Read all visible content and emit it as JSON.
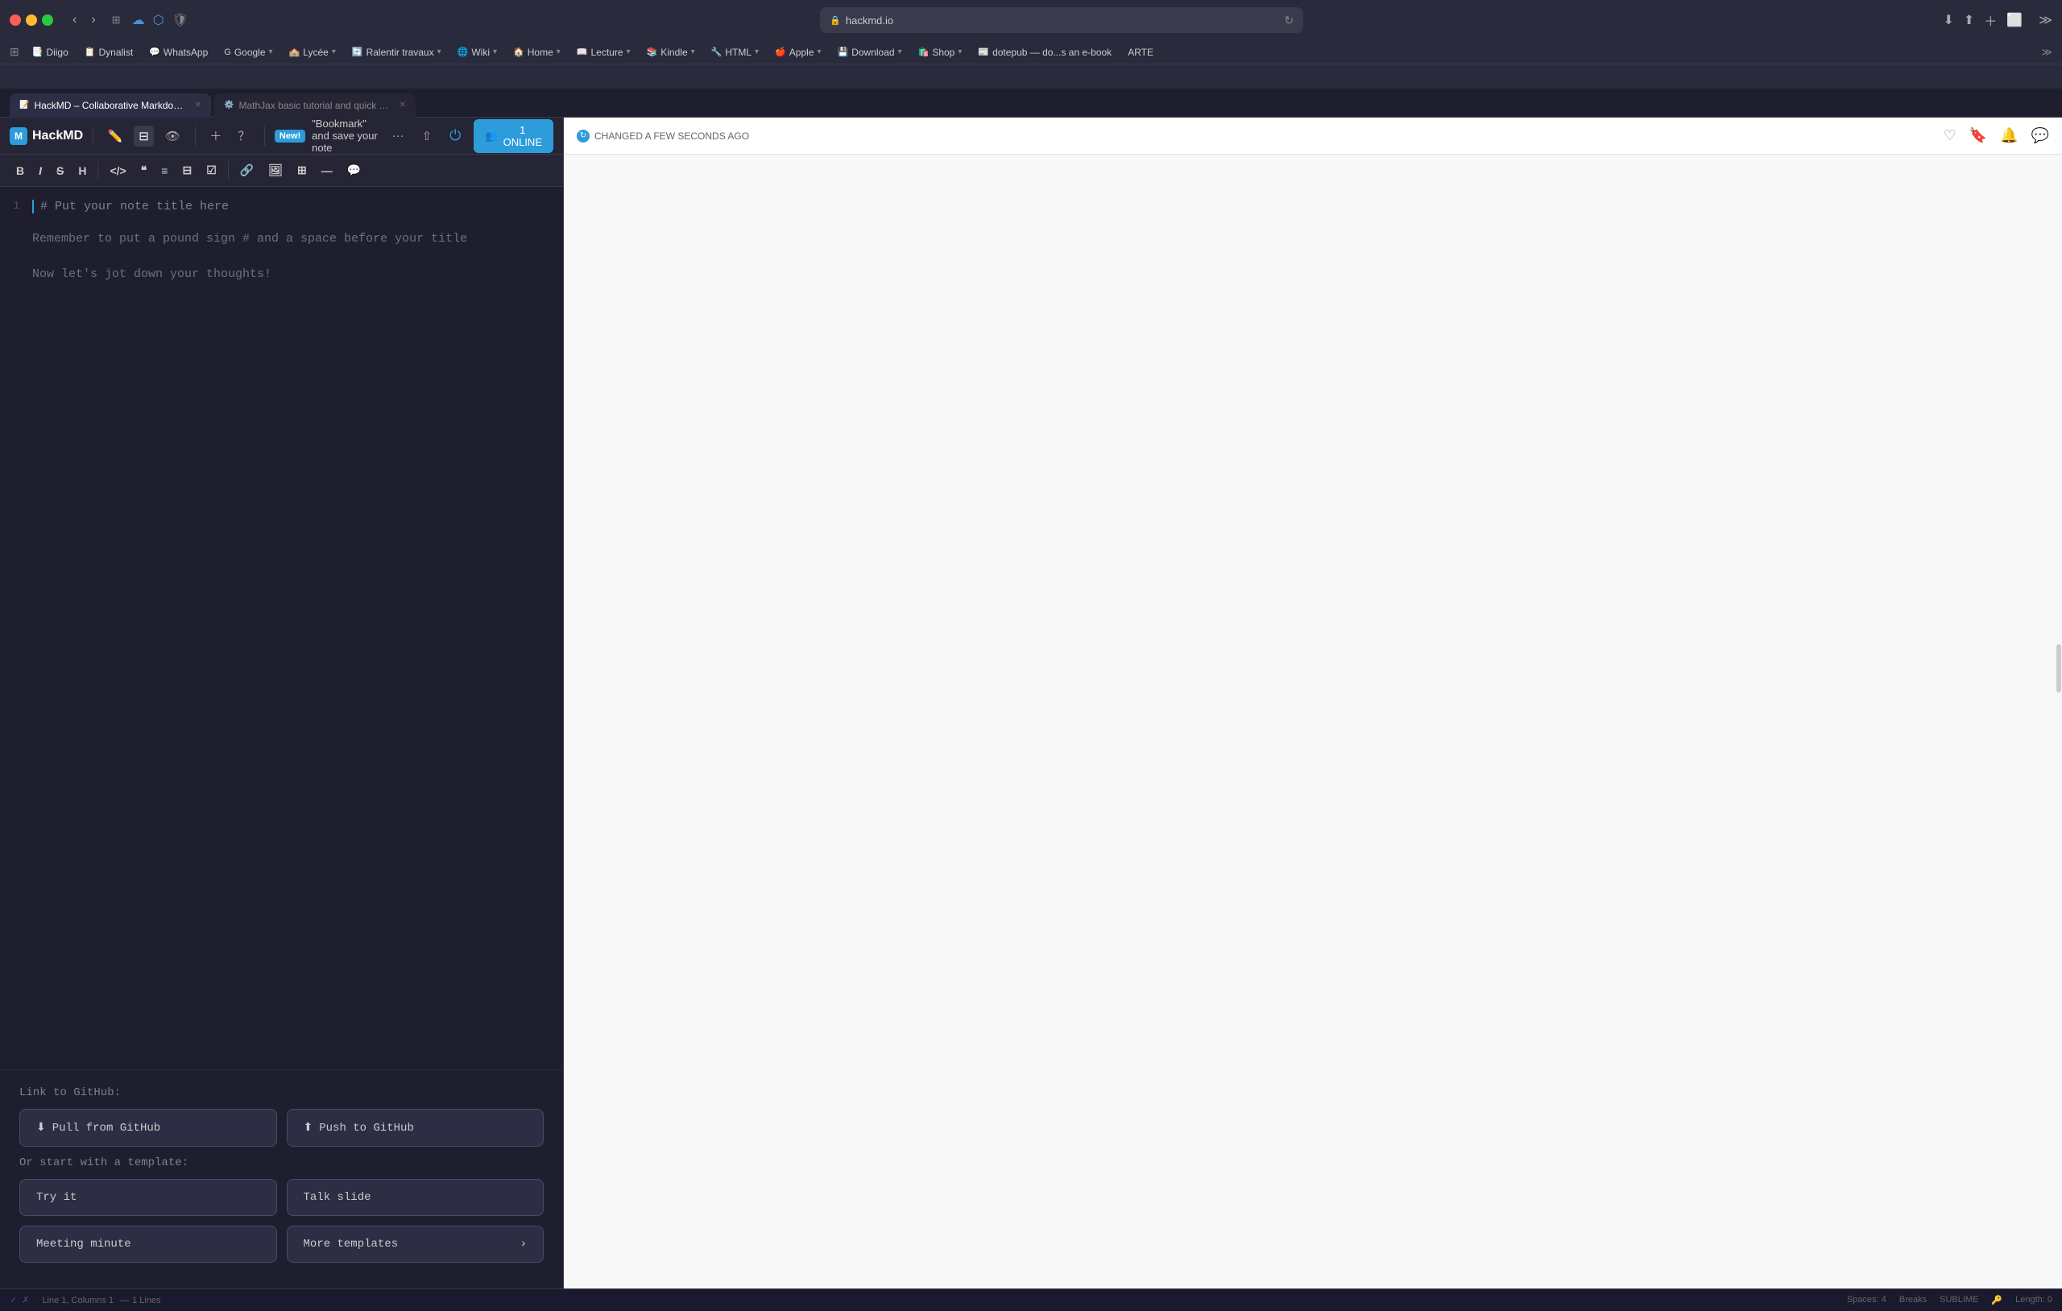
{
  "browser": {
    "url": "hackmd.io",
    "tabs": [
      {
        "id": "tab1",
        "title": "HackMD – Collaborative Markdown Knowledge Base",
        "icon": "📝",
        "active": true
      },
      {
        "id": "tab2",
        "title": "MathJax basic tutorial and quick reference – Mathematics Meta Stack Exchange",
        "icon": "⚙️",
        "active": false
      }
    ],
    "bookmarks": [
      {
        "id": "diigo",
        "icon": "📑",
        "label": "Diigo"
      },
      {
        "id": "dynalist",
        "icon": "📋",
        "label": "Dynalist"
      },
      {
        "id": "whatsapp",
        "icon": "💬",
        "label": "WhatsApp"
      },
      {
        "id": "google",
        "icon": "G",
        "label": "Google"
      },
      {
        "id": "lycee",
        "icon": "🏫",
        "label": "Lycée"
      },
      {
        "id": "ralentir",
        "icon": "🔄",
        "label": "Ralentir travaux"
      },
      {
        "id": "wiki",
        "icon": "🌐",
        "label": "Wiki"
      },
      {
        "id": "home",
        "icon": "🏠",
        "label": "Home"
      },
      {
        "id": "lecture",
        "icon": "📖",
        "label": "Lecture"
      },
      {
        "id": "kindle",
        "icon": "📚",
        "label": "Kindle"
      },
      {
        "id": "html",
        "icon": "🔧",
        "label": "HTML"
      },
      {
        "id": "apple",
        "icon": "🍎",
        "label": "Apple"
      },
      {
        "id": "download",
        "icon": "💾",
        "label": "Download"
      },
      {
        "id": "shop",
        "icon": "🛍️",
        "label": "Shop"
      },
      {
        "id": "dotepub",
        "icon": "📰",
        "label": "dotepub — do...s an e-book"
      },
      {
        "id": "arte",
        "icon": "📺",
        "label": "ARTE"
      }
    ]
  },
  "hackmd": {
    "logo": "HackMD",
    "logo_icon": "M",
    "new_badge": "New!",
    "bookmark_msg": "\"Bookmark\" and save your note",
    "online_count": "1 ONLINE",
    "sync_status": "CHANGED A FEW SECONDS AGO",
    "editor": {
      "line_number": "1",
      "title_placeholder": "# Put your note title here",
      "body_line1": "Remember to put a pound sign # and a space before your title",
      "body_line2": "Now let's jot down your thoughts!"
    },
    "github": {
      "label": "Link to GitHub:",
      "pull_btn": "Pull from GitHub",
      "push_btn": "Push to GitHub"
    },
    "templates": {
      "label": "Or start with a template:",
      "try_btn": "Try it",
      "talk_btn": "Talk slide",
      "meeting_btn": "Meeting minute",
      "more_btn": "More templates"
    }
  },
  "status_bar": {
    "line_col": "Line 1, Columns 1",
    "lines": "1 Lines",
    "spaces": "Spaces: 4",
    "breaks": "Breaks",
    "sublime": "SUBLIME",
    "length": "Length: 0"
  },
  "format_toolbar": {
    "buttons": [
      "B",
      "I",
      "S",
      "H",
      "</>",
      "❝",
      "≡",
      "⊟",
      "☑",
      "🔗",
      "🖼",
      "⊞",
      "—",
      "💬"
    ]
  },
  "colors": {
    "accent": "#2d9cdb",
    "bg_dark": "#1e1e2e",
    "bg_panel": "#252535",
    "border": "#3a3a4d"
  }
}
